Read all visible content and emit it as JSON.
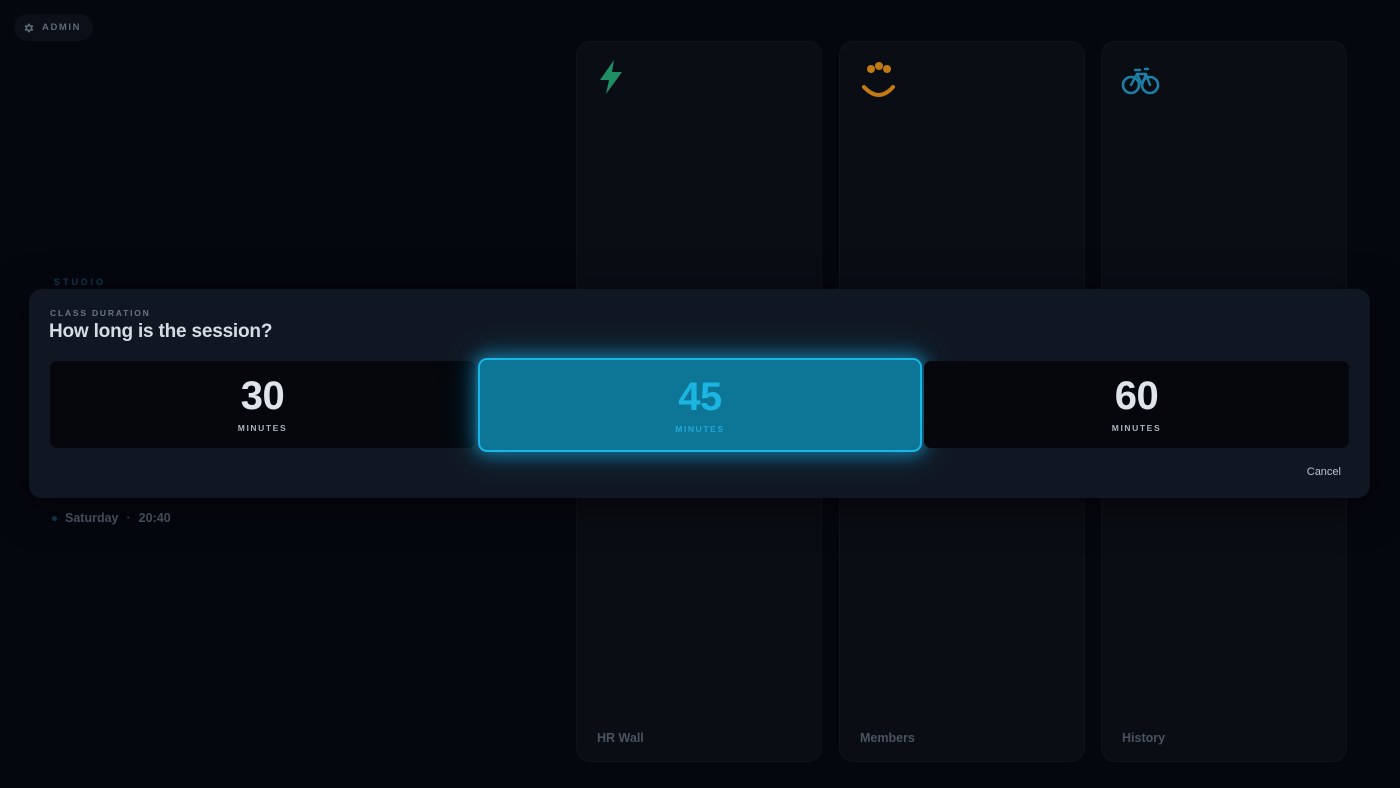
{
  "admin": {
    "label": "ADMIN",
    "icon": "gear-icon"
  },
  "studio": {
    "label": "STUDIO"
  },
  "status": {
    "day": "Saturday",
    "separator": "·",
    "time": "20:40"
  },
  "cards": [
    {
      "label": "HR Wall",
      "icon": "lightning-icon",
      "color": "#1f8f63"
    },
    {
      "label": "Members",
      "icon": "smiley-icon",
      "color": "#c27a12"
    },
    {
      "label": "History",
      "icon": "bicycle-icon",
      "color": "#1d7fa6"
    }
  ],
  "modal": {
    "eyebrow": "CLASS DURATION",
    "title": "How long is the session?",
    "options": [
      {
        "value": "30",
        "unit": "MINUTES",
        "selected": false
      },
      {
        "value": "45",
        "unit": "MINUTES",
        "selected": true
      },
      {
        "value": "60",
        "unit": "MINUTES",
        "selected": false
      }
    ],
    "cancel_label": "Cancel"
  },
  "colors": {
    "accent": "#19b6e6",
    "selected_fill": "#0d7595",
    "background": "#05070f",
    "modal": "#111722"
  }
}
